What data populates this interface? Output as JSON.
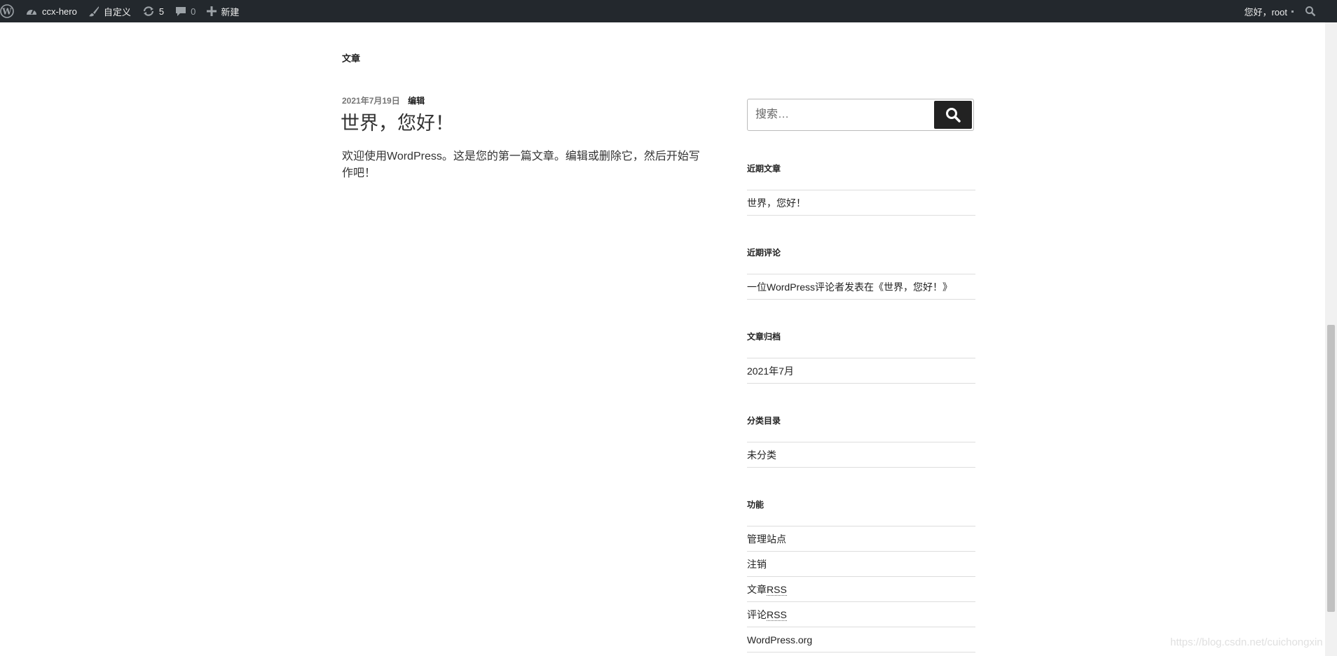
{
  "adminbar": {
    "site_name": "ccx-hero",
    "customize": "自定义",
    "updates_count": "5",
    "comments_count": "0",
    "new_label": "新建",
    "greeting": "您好，root"
  },
  "main": {
    "section_title": "文章",
    "post": {
      "date": "2021年7月19日",
      "edit": "编辑",
      "title": "世界，您好！",
      "body": "欢迎使用WordPress。这是您的第一篇文章。编辑或删除它，然后开始写作吧！"
    }
  },
  "sidebar": {
    "search": {
      "placeholder": "搜索…"
    },
    "recent_posts": {
      "title": "近期文章",
      "items": [
        "世界，您好！"
      ]
    },
    "recent_comments": {
      "title": "近期评论",
      "items": [
        "一位WordPress评论者发表在《世界，您好！》"
      ]
    },
    "archives": {
      "title": "文章归档",
      "items": [
        "2021年7月"
      ]
    },
    "categories": {
      "title": "分类目录",
      "items": [
        "未分类"
      ]
    },
    "meta": {
      "title": "功能",
      "items": [
        "管理站点",
        "注销",
        "文章",
        "RSS",
        "评论",
        "RSS",
        "WordPress.org"
      ]
    }
  },
  "watermark": "https://blog.csdn.net/cuichongxin"
}
